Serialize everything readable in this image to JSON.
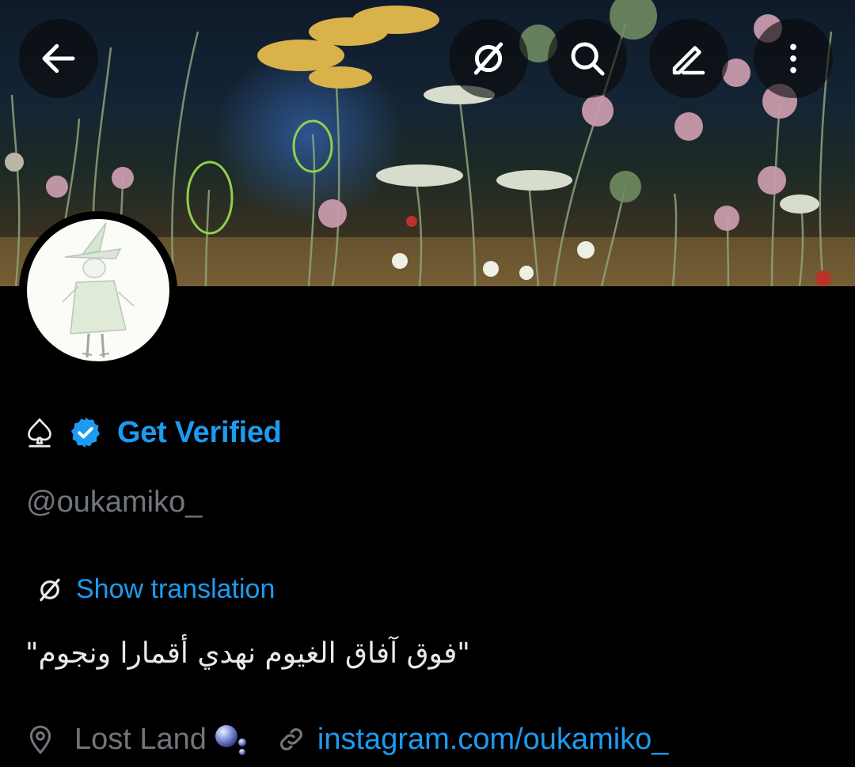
{
  "header": {
    "back_icon": "arrow-left-icon",
    "actions": [
      "translate-icon",
      "search-icon",
      "edit-icon",
      "more-vertical-icon"
    ]
  },
  "profile": {
    "spade_icon": "spade-icon",
    "verified_badge_icon": "verified-badge-icon",
    "get_verified": "Get Verified",
    "handle": "@oukamiko_",
    "show_translation": "Show translation",
    "bio": "\"فوق آفاق الغيوم نهدي أقمارا ونجوم\"",
    "location": "Lost Land",
    "link": "instagram.com/oukamiko_"
  },
  "colors": {
    "accent": "#1d9bf0",
    "secondary_text": "#71767b",
    "background": "#000000"
  }
}
